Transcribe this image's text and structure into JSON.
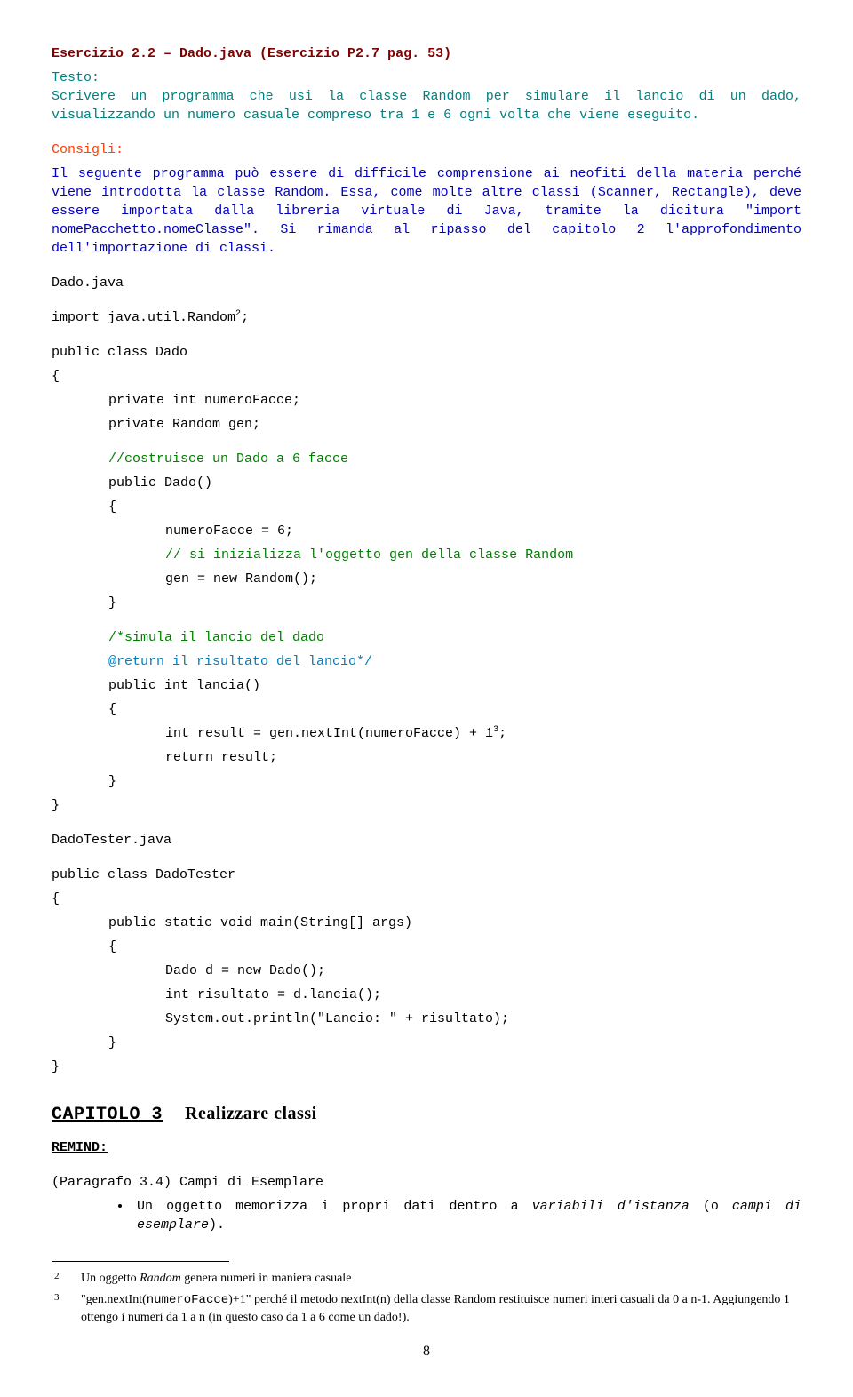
{
  "title1": "Esercizio 2.2 – Dado.java (Esercizio P2.7 pag. 53)",
  "testo_label": "Testo:",
  "testo_body": "Scrivere un programma che usi la classe Random per simulare il lancio di un dado, visualizzando un numero casuale compreso tra 1 e 6 ogni volta che viene eseguito.",
  "consigli_label": "Consigli:",
  "consigli_p1": "Il seguente programma può essere di difficile comprensione ai neofiti della materia perché viene introdotta la classe Random. Essa, come molte altre classi (Scanner, Rectangle), deve essere importata dalla libreria virtuale di Java, tramite la dicitura \"import nomePacchetto.nomeClasse\". Si rimanda al ripasso del capitolo 2 l'approfondimento dell'importazione di classi.",
  "dado_java": "Dado.java",
  "code1_a": "import java.util.Random",
  "code1_b": ";",
  "code2": "public class Dado",
  "lbrace": "{",
  "rbrace": "}",
  "code3": "private int numeroFacce;",
  "code4": "private Random gen;",
  "cmt1": "//costruisce un Dado a 6 facce",
  "code5": "public Dado()",
  "code6": "numeroFacce = 6;",
  "cmt2": "// si inizializza l'oggetto gen della classe Random",
  "code7": "gen = new Random();",
  "cmt3a": "/*simula il lancio del dado",
  "cmt3b": "@return il risultato del lancio*/",
  "code8": "public int lancia()",
  "code9a": "int result = gen.nextInt(numeroFacce) + 1",
  "code9b": ";",
  "code10": "return result;",
  "dadotester_java": "DadoTester.java",
  "code11": "public class DadoTester",
  "code12": "public static void main(String[] args)",
  "code13": "Dado d = new Dado();",
  "code14": "int risultato = d.lancia();",
  "code15": "System.out.println(\"Lancio: \" + risultato);",
  "cap3_a": "CAPITOLO 3",
  "cap3_b": "Realizzare classi",
  "remind": "REMIND:",
  "parag": "(Paragrafo 3.4) Campi di Esemplare",
  "bullet1_a": "Un oggetto memorizza i propri dati dentro a ",
  "bullet1_b": "variabili d'istanza",
  "bullet1_c": " (o ",
  "bullet1_d": "campi di esemplare",
  "bullet1_e": ").",
  "fn2_num": "2",
  "fn2_txt": "Un oggetto ",
  "fn2_txt_i": "Random",
  "fn2_txt2": " genera numeri in maniera casuale",
  "fn3_num": "3",
  "fn3_txt": "\"gen.nextInt(",
  "fn3_mono": "numeroFacce",
  "fn3_txt2": ")+1\" perché il metodo nextInt(n) della classe Random restituisce numeri interi casuali da 0 a n-1. Aggiungendo 1 ottengo i numeri da 1 a n (in questo caso da 1 a 6 come un dado!).",
  "pagenum": "8",
  "sup2": "2",
  "sup3": "3"
}
